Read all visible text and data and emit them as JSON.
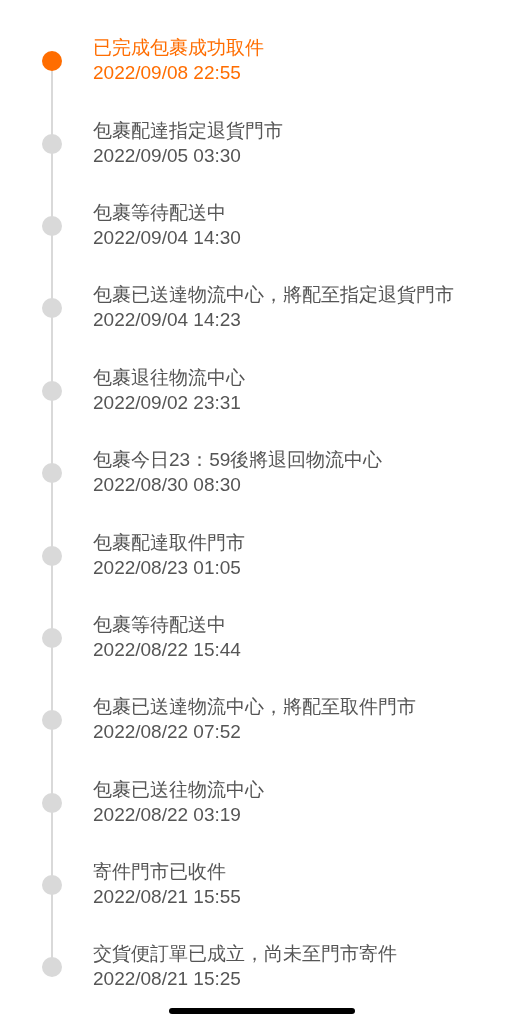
{
  "events": [
    {
      "title": "已完成包裹成功取件",
      "time": "2022/09/08 22:55",
      "current": true
    },
    {
      "title": "包裹配達指定退貨門市",
      "time": "2022/09/05 03:30",
      "current": false
    },
    {
      "title": "包裹等待配送中",
      "time": "2022/09/04 14:30",
      "current": false
    },
    {
      "title": "包裹已送達物流中心，將配至指定退貨門市",
      "time": "2022/09/04 14:23",
      "current": false
    },
    {
      "title": "包裹退往物流中心",
      "time": "2022/09/02 23:31",
      "current": false
    },
    {
      "title": "包裹今日23：59後將退回物流中心",
      "time": "2022/08/30 08:30",
      "current": false
    },
    {
      "title": "包裹配達取件門市",
      "time": "2022/08/23 01:05",
      "current": false
    },
    {
      "title": "包裹等待配送中",
      "time": "2022/08/22 15:44",
      "current": false
    },
    {
      "title": "包裹已送達物流中心，將配至取件門市",
      "time": "2022/08/22 07:52",
      "current": false
    },
    {
      "title": "包裹已送往物流中心",
      "time": "2022/08/22 03:19",
      "current": false
    },
    {
      "title": "寄件門市已收件",
      "time": "2022/08/21 15:55",
      "current": false
    },
    {
      "title": "交貨便訂單已成立，尚未至門市寄件",
      "time": "2022/08/21 15:25",
      "current": false
    }
  ]
}
